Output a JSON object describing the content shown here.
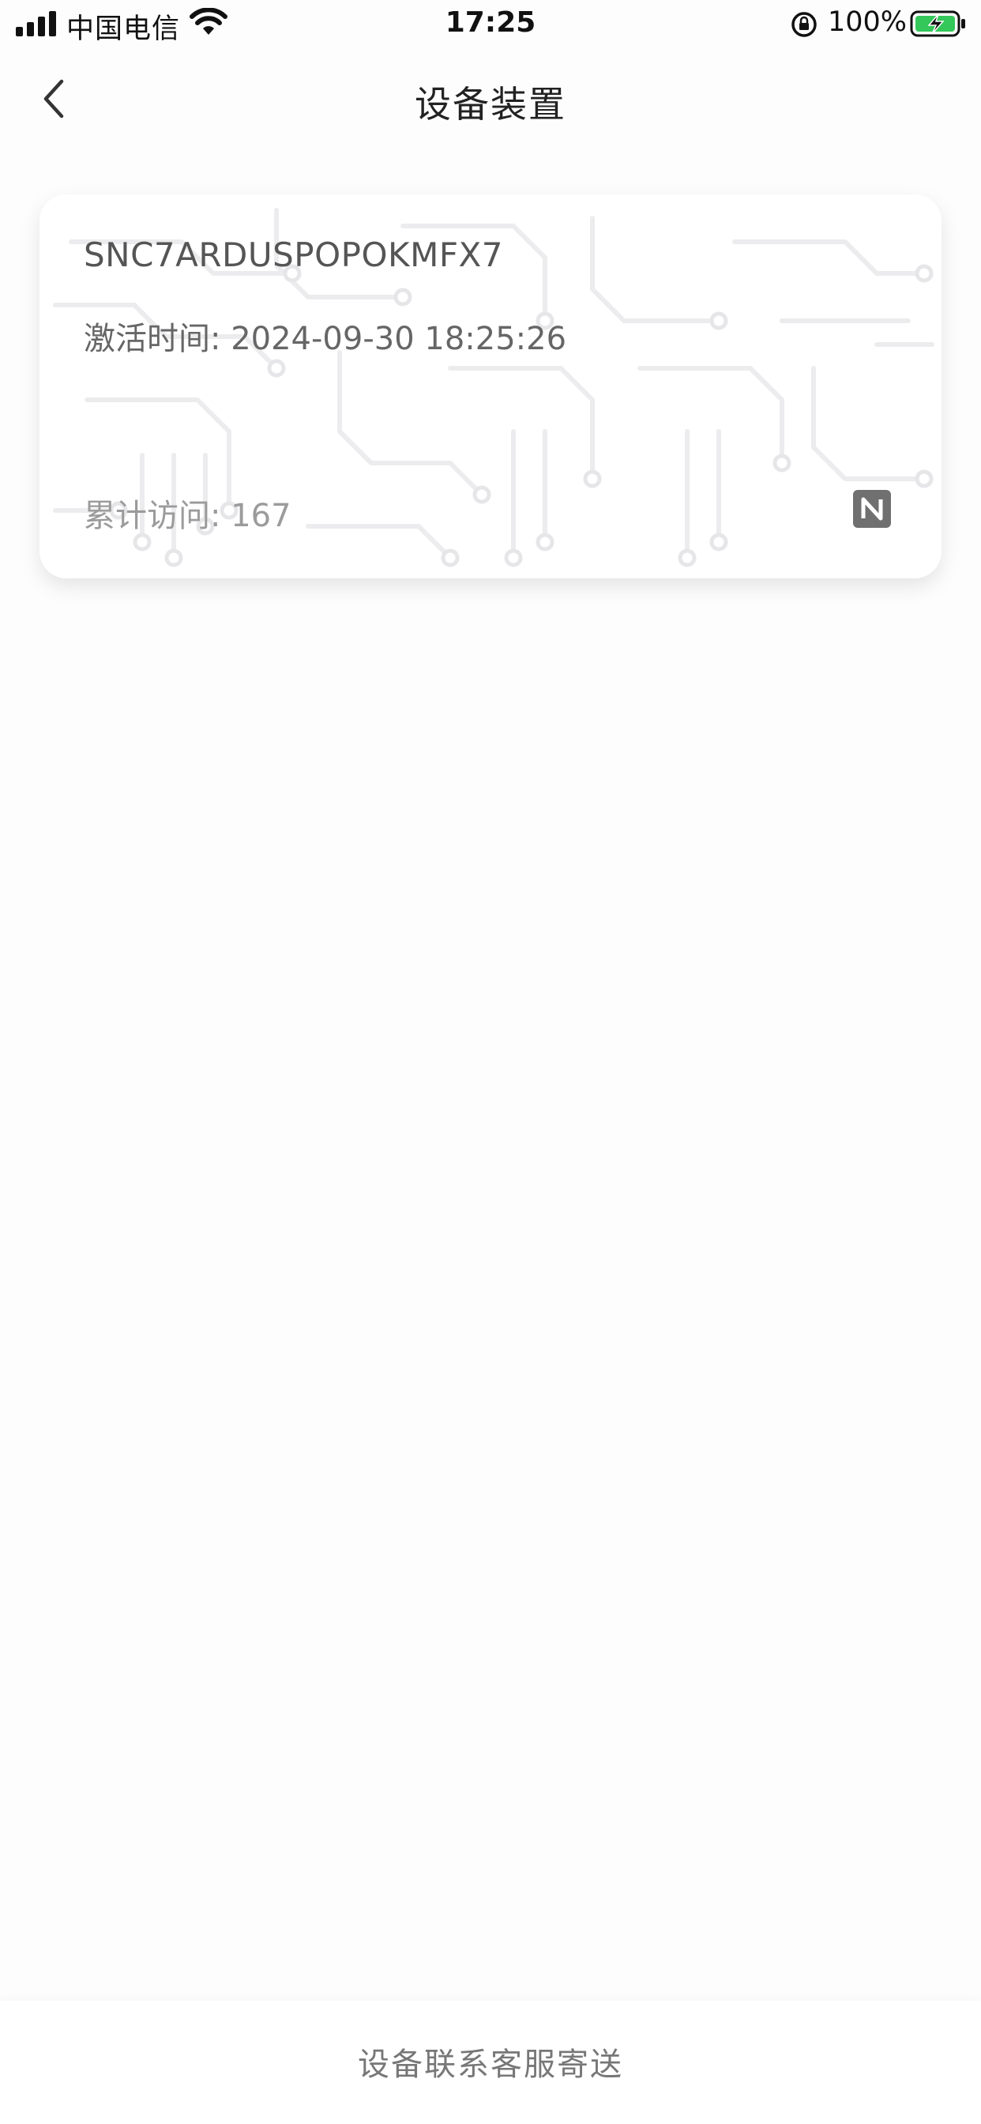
{
  "status_bar": {
    "carrier": "中国电信",
    "time": "17:25",
    "battery_percent": "100%"
  },
  "nav": {
    "title": "设备装置"
  },
  "device_card": {
    "serial": "SNC7ARDUSPOPOKMFX7",
    "activation_label": "激活时间: ",
    "activation_time": "2024-09-30 18:25:26",
    "visits_label": "累计访问: ",
    "visits_count": "167"
  },
  "bottom": {
    "contact_label": "设备联系客服寄送"
  },
  "colors": {
    "background": "#fdfdfe",
    "card_background": "#ffffff",
    "battery_charging": "#34c759"
  },
  "icons": [
    "cellular-signal-icon",
    "wifi-icon",
    "orientation-lock-icon",
    "battery-charging-icon",
    "back-chevron-icon",
    "nfc-icon"
  ]
}
